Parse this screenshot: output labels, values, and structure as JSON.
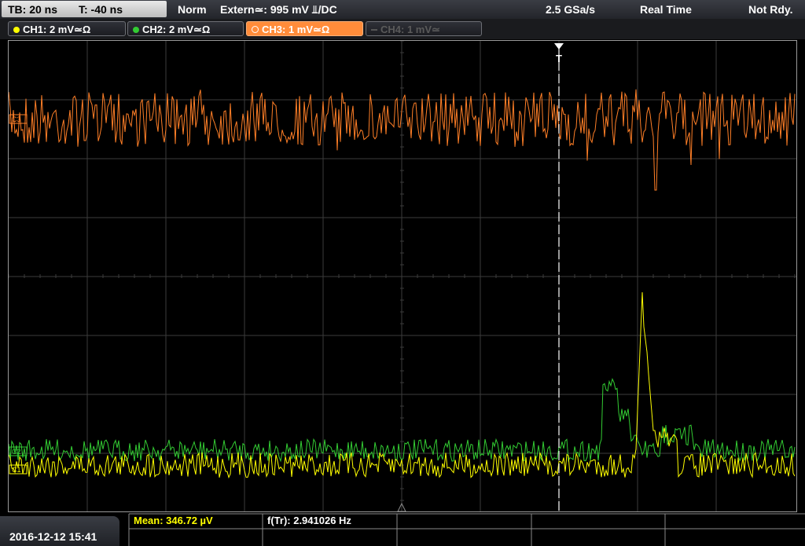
{
  "header": {
    "timebase": "TB: 20 ns",
    "trigger_offset": "T: -40 ns",
    "trigger_mode": "Norm",
    "trigger_source": "Extern≃: 995 mV ⫫/DC",
    "sample_rate": "2.5 GSa/s",
    "acq_mode": "Real Time",
    "status": "Not Rdy."
  },
  "channels": [
    {
      "label": "CH1: 2 mV≃Ω",
      "color": "#ffff00",
      "active": true
    },
    {
      "label": "CH2: 2 mV≃Ω",
      "color": "#33cc33",
      "active": true
    },
    {
      "label": "CH3: 1 mV≃Ω",
      "color": "#ff7f27",
      "active": true,
      "selected": true
    },
    {
      "label": "CH4: 1 mV≃",
      "color": "#555555",
      "active": false
    }
  ],
  "markers": {
    "trigger_label": "T",
    "ch1_tag": "C1",
    "ch2_tag": "C2",
    "ch3_tag": "C3"
  },
  "measurements": {
    "mean": "Mean: 346.72 µV",
    "freq": "f(Tr): 2.941026 Hz"
  },
  "footer": {
    "datetime": "2016-12-12 15:41"
  },
  "colors": {
    "ch1": "#ffff00",
    "ch2": "#33cc33",
    "ch3": "#ff7f27",
    "grid": "#3c3c3c",
    "trigger_line": "#ffffff"
  }
}
